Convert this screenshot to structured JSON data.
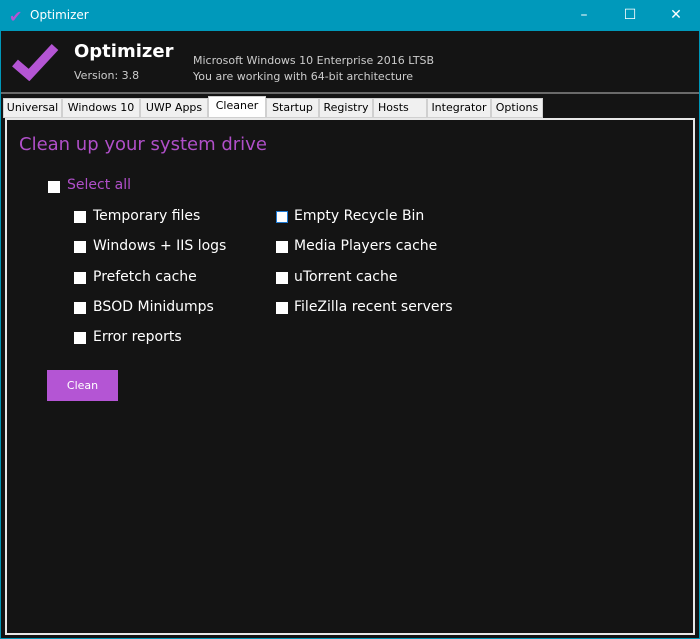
{
  "window": {
    "title": "Optimizer"
  },
  "header": {
    "app_name": "Optimizer",
    "version": "Version: 3.8",
    "os_line": "Microsoft Windows 10 Enterprise 2016 LTSB",
    "arch_line": "You are working with 64-bit architecture"
  },
  "tabs": [
    "Universal",
    "Windows 10",
    "UWP Apps",
    "Cleaner",
    "Startup",
    "Registry",
    "Hosts",
    "Integrator",
    "Options"
  ],
  "selected_tab": "Cleaner",
  "cleaner": {
    "title": "Clean up your system drive",
    "select_all": "Select all",
    "col1": [
      "Temporary files",
      "Windows + IIS logs",
      "Prefetch cache",
      "BSOD Minidumps",
      "Error reports"
    ],
    "col2": [
      "Empty Recycle Bin",
      "Media Players cache",
      "uTorrent cache",
      "FileZilla recent servers"
    ],
    "clean_label": "Clean"
  },
  "colors": {
    "accent": "#b455d4",
    "titlebar": "#0099bb",
    "background": "#141414"
  }
}
